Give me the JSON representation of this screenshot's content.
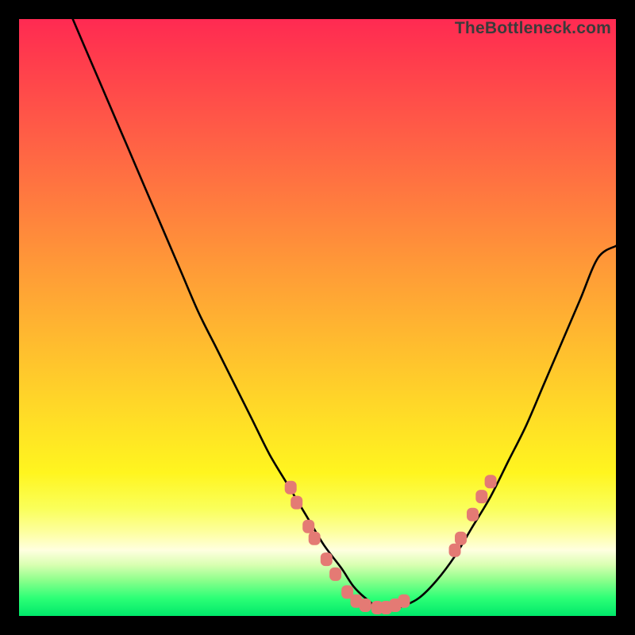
{
  "watermark": "TheBottleneck.com",
  "chart_data": {
    "type": "line",
    "title": "",
    "xlabel": "",
    "ylabel": "",
    "xlim": [
      0,
      100
    ],
    "ylim": [
      0,
      100
    ],
    "grid": false,
    "legend": false,
    "series": [
      {
        "name": "bottleneck-curve",
        "x": [
          9,
          12,
          15,
          18,
          21,
          24,
          27,
          30,
          33,
          36,
          39,
          42,
          45,
          48,
          51,
          54,
          56,
          58,
          60,
          62,
          64,
          67,
          70,
          73,
          76,
          79,
          82,
          85,
          88,
          91,
          94,
          97,
          100
        ],
        "y": [
          100,
          93,
          86,
          79,
          72,
          65,
          58,
          51,
          45,
          39,
          33,
          27,
          22,
          17,
          12,
          8,
          5,
          3,
          1.5,
          1,
          1.5,
          3,
          6,
          10,
          15,
          20,
          26,
          32,
          39,
          46,
          53,
          60,
          62
        ]
      }
    ],
    "markers": [
      {
        "name": "left-marker-cluster",
        "color": "#e47a74",
        "points": [
          {
            "x": 45.5,
            "y": 21.5
          },
          {
            "x": 46.5,
            "y": 19
          },
          {
            "x": 48.5,
            "y": 15
          },
          {
            "x": 49.5,
            "y": 13
          },
          {
            "x": 51.5,
            "y": 9.5
          },
          {
            "x": 53,
            "y": 7
          },
          {
            "x": 55,
            "y": 4
          },
          {
            "x": 56.5,
            "y": 2.5
          },
          {
            "x": 58,
            "y": 1.8
          },
          {
            "x": 60,
            "y": 1.4
          },
          {
            "x": 61.5,
            "y": 1.4
          },
          {
            "x": 63,
            "y": 1.8
          },
          {
            "x": 64.5,
            "y": 2.5
          }
        ]
      },
      {
        "name": "right-marker-cluster",
        "color": "#e47a74",
        "points": [
          {
            "x": 73,
            "y": 11
          },
          {
            "x": 74,
            "y": 13
          },
          {
            "x": 76,
            "y": 17
          },
          {
            "x": 77.5,
            "y": 20
          },
          {
            "x": 79,
            "y": 22.5
          }
        ]
      }
    ]
  }
}
